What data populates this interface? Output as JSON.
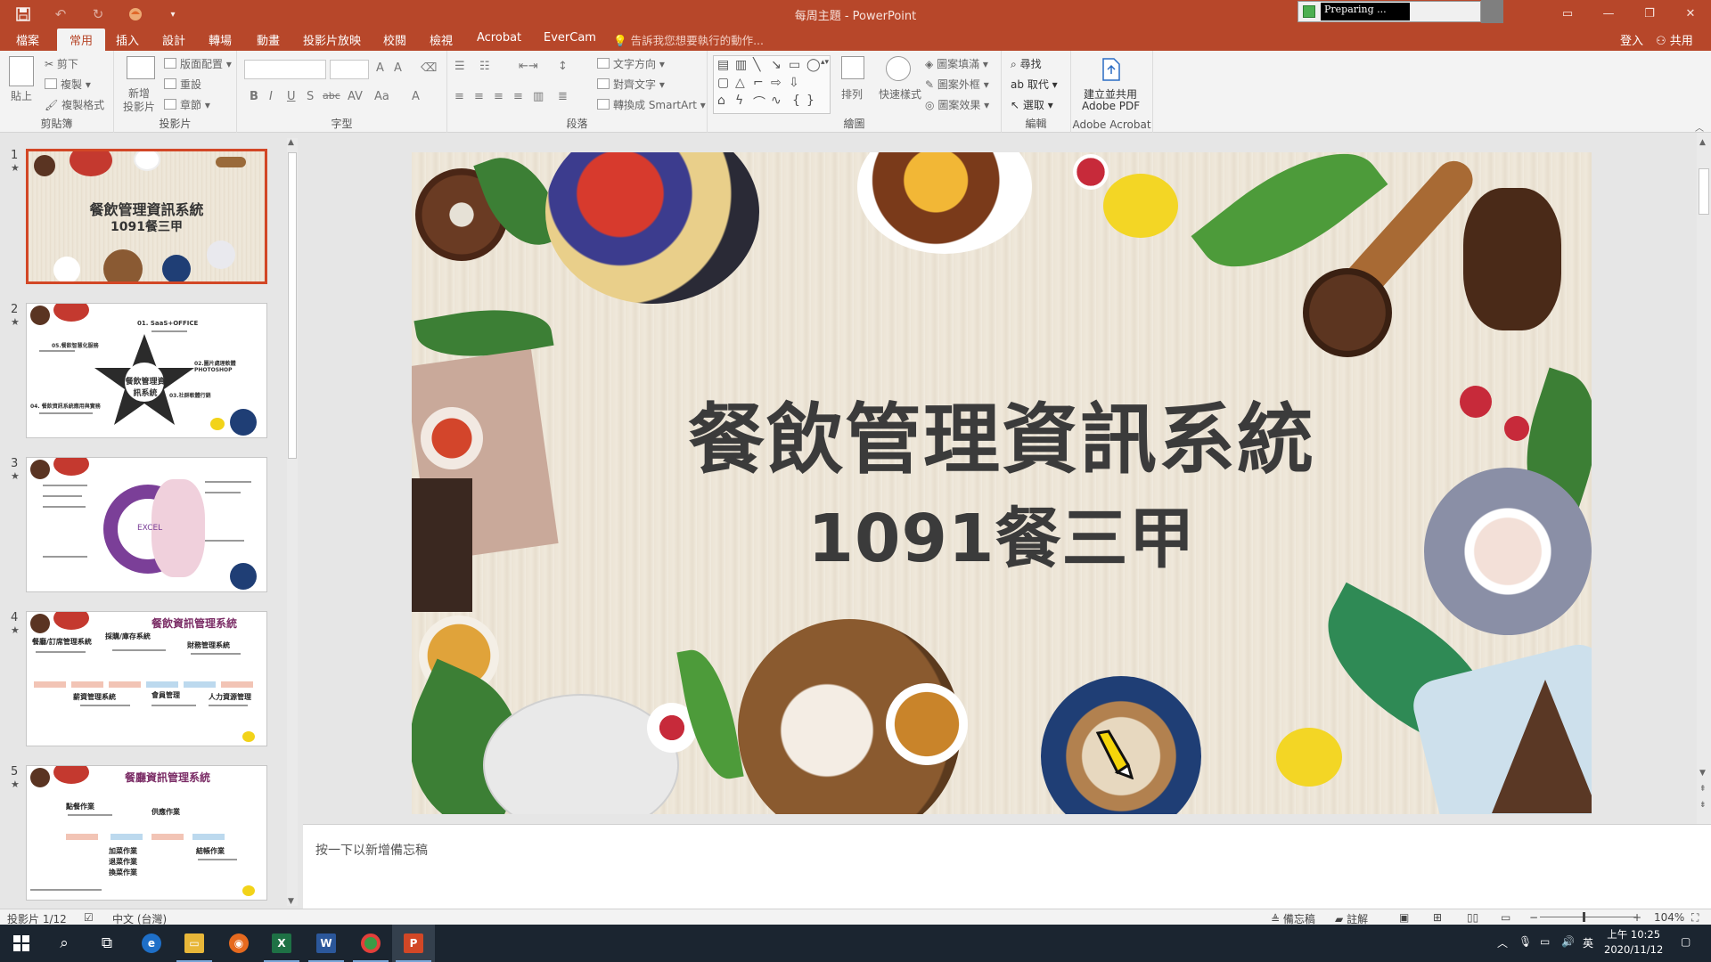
{
  "window": {
    "title": "每周主題 - PowerPoint",
    "preparing": "Preparing ..."
  },
  "tabs": {
    "file": "檔案",
    "home": "常用",
    "insert": "插入",
    "design": "設計",
    "transitions": "轉場",
    "animations": "動畫",
    "slideshow": "投影片放映",
    "review": "校閱",
    "view": "檢視",
    "acrobat": "Acrobat",
    "evercam": "EverCam",
    "tellme": "告訴我您想要執行的動作...",
    "signin": "登入",
    "share": "共用"
  },
  "ribbon": {
    "clipboard": {
      "label": "剪貼簿",
      "paste": "貼上",
      "cut": "剪下",
      "copy": "複製",
      "format_painter": "複製格式"
    },
    "slides": {
      "label": "投影片",
      "new_slide_1": "新增",
      "new_slide_2": "投影片",
      "layout": "版面配置",
      "reset": "重設",
      "section": "章節"
    },
    "font": {
      "label": "字型",
      "bold": "B",
      "italic": "I",
      "underline": "U",
      "shadow": "S",
      "strike": "abc"
    },
    "paragraph": {
      "label": "段落",
      "text_direction": "文字方向",
      "align_text": "對齊文字",
      "smartart": "轉換成 SmartArt"
    },
    "drawing": {
      "label": "繪圖",
      "arrange": "排列",
      "quick_styles": "快速樣式",
      "shape_fill": "圖案填滿",
      "shape_outline": "圖案外框",
      "shape_effects": "圖案效果"
    },
    "editing": {
      "label": "編輯",
      "find": "尋找",
      "replace": "取代",
      "select": "選取"
    },
    "acrobat": {
      "label": "Adobe Acrobat",
      "create_1": "建立並共用",
      "create_2": "Adobe PDF"
    }
  },
  "thumbnails": [
    {
      "num": "1",
      "title": "餐飲管理資訊系統",
      "subtitle": "1091餐三甲"
    },
    {
      "num": "2",
      "center": "餐飲管理資訊系統",
      "item1": "01. SaaS+OFFICE",
      "item2": "02.圖片處理軟體 PHOTOSHOP",
      "item3": "03.社群軟體行銷",
      "item4": "04. 餐飲資訊系統應用與實務",
      "item5": "05.餐飲智慧化服務"
    },
    {
      "num": "3",
      "center": "EXCEL"
    },
    {
      "num": "4",
      "title": "餐飲資訊管理系統",
      "b1": "餐廳/訂席管理系統",
      "b2": "採購/庫存系統",
      "b3": "財務管理系統",
      "b4": "薪資管理系統",
      "b5": "會員管理",
      "b6": "人力資源管理"
    },
    {
      "num": "5",
      "title": "餐廳資訊管理系統",
      "b1": "點餐作業",
      "b2": "供應作業",
      "b3": "加菜作業",
      "b4": "結帳作業",
      "b5": "退菜作業",
      "b6": "換菜作業"
    }
  ],
  "slide": {
    "title": "餐飲管理資訊系統",
    "subtitle": "1091餐三甲"
  },
  "notes": {
    "placeholder": "按一下以新增備忘稿"
  },
  "status": {
    "slide_count": "投影片 1/12",
    "language": "中文 (台灣)",
    "notes": "備忘稿",
    "comments": "註解",
    "zoom": "104%"
  },
  "clock": {
    "time": "上午 10:25",
    "date": "2020/11/12"
  },
  "tray": {
    "ime": "英"
  },
  "colors": {
    "accent": "#b7472a",
    "selected_thumb": "#d24726",
    "taskbar": "#1b2530"
  }
}
